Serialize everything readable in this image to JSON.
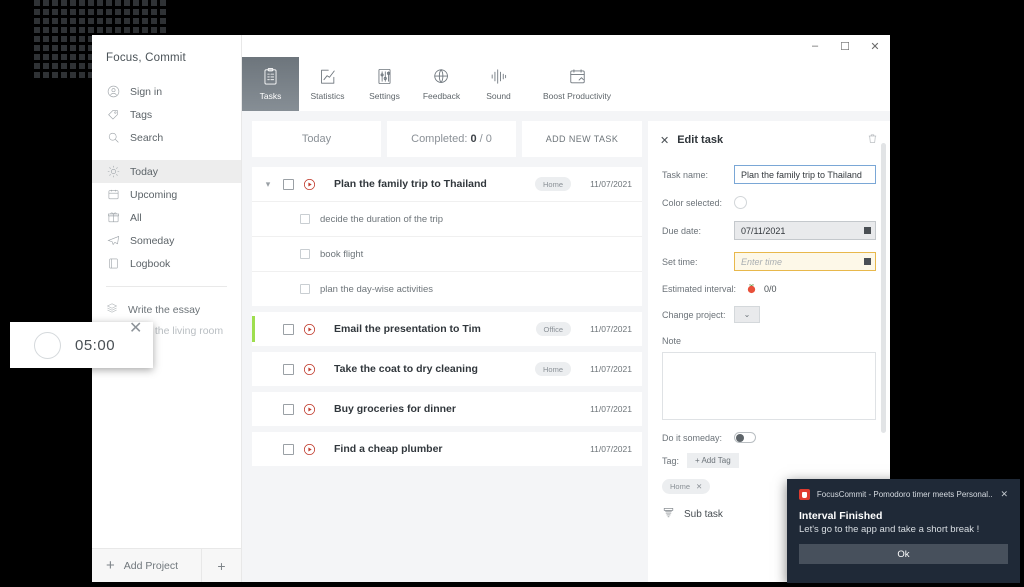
{
  "window": {
    "controls": {
      "minimize": "–",
      "maximize": "☐",
      "close": "✕"
    }
  },
  "sidebar": {
    "brand": "Focus, Commit",
    "top_items": [
      {
        "label": "Sign in",
        "icon": "user-icon"
      },
      {
        "label": "Tags",
        "icon": "tag-icon"
      },
      {
        "label": "Search",
        "icon": "search-icon"
      }
    ],
    "nav_items": [
      {
        "label": "Today",
        "icon": "sun-icon",
        "active": true
      },
      {
        "label": "Upcoming",
        "icon": "calendar-icon",
        "active": false
      },
      {
        "label": "All",
        "icon": "box-icon",
        "active": false
      },
      {
        "label": "Someday",
        "icon": "paper-plane-icon",
        "active": false
      },
      {
        "label": "Logbook",
        "icon": "book-icon",
        "active": false
      }
    ],
    "projects": [
      {
        "label": "Write the essay",
        "icon": "layers-icon"
      },
      {
        "label": "Paint the living room",
        "icon": "layers-icon"
      }
    ],
    "footer": {
      "add_project": "Add Project",
      "plus": "+",
      "add_more": "+"
    }
  },
  "ribbon": {
    "tabs": [
      {
        "label": "Tasks",
        "icon": "clipboard-icon",
        "active": true
      },
      {
        "label": "Statistics",
        "icon": "chart-check-icon",
        "active": false
      },
      {
        "label": "Settings",
        "icon": "sliders-icon",
        "active": false
      },
      {
        "label": "Feedback",
        "icon": "globe-icon",
        "active": false
      },
      {
        "label": "Sound",
        "icon": "waveform-icon",
        "active": false
      },
      {
        "label": "Boost Productivity",
        "icon": "calendar-plus-icon",
        "active": false
      }
    ]
  },
  "list_header": {
    "today": "Today",
    "completed_label": "Completed:",
    "completed_done": "0",
    "completed_total": "/ 0",
    "add_new_task": "ADD NEW TASK"
  },
  "tasks": [
    {
      "title": "Plan the family trip to Thailand",
      "tag": "Home",
      "date": "11/07/2021",
      "expanded": true,
      "accent": false,
      "subtasks": [
        "decide the duration of the trip",
        "book flight",
        "plan the day-wise activities"
      ]
    },
    {
      "title": "Email the presentation to Tim",
      "tag": "Office",
      "date": "11/07/2021",
      "expanded": false,
      "accent": true,
      "subtasks": []
    },
    {
      "title": "Take the coat to dry cleaning",
      "tag": "Home",
      "date": "11/07/2021",
      "expanded": false,
      "accent": false,
      "subtasks": []
    },
    {
      "title": "Buy groceries for dinner",
      "tag": "",
      "date": "11/07/2021",
      "expanded": false,
      "accent": false,
      "subtasks": []
    },
    {
      "title": "Find a cheap plumber",
      "tag": "",
      "date": "11/07/2021",
      "expanded": false,
      "accent": false,
      "subtasks": []
    }
  ],
  "edit_panel": {
    "title": "Edit task",
    "close": "✕",
    "task_name_label": "Task name:",
    "task_name_value": "Plan the family trip to Thailand",
    "color_label": "Color selected:",
    "due_date_label": "Due date:",
    "due_date_value": "07/11/2021",
    "set_time_label": "Set time:",
    "set_time_placeholder": "Enter time",
    "set_time_value": "",
    "estimated_interval_label": "Estimated interval:",
    "estimated_interval_value": "0/0",
    "change_project_label": "Change project:",
    "change_project_value": "⌄",
    "note_label": "Note",
    "note_value": "",
    "someday_label": "Do it someday:",
    "someday_on": false,
    "tag_label": "Tag:",
    "add_tag": "+ Add Tag",
    "chips": [
      {
        "label": "Home",
        "remove": "✕"
      }
    ],
    "sub_task": "Sub task"
  },
  "timer": {
    "time": "05:00",
    "close": "✕"
  },
  "toast": {
    "app_name": "FocusCommit - Pomodoro timer meets Personal...",
    "close": "✕",
    "title": "Interval Finished",
    "body": "Let's go to the app and take a short break !",
    "ok": "Ok"
  },
  "colors": {
    "accent_green": "#9ede4e",
    "tomato_red": "#e8503a",
    "toast_bg": "#1f2937",
    "active_tab": "#7a828a"
  }
}
